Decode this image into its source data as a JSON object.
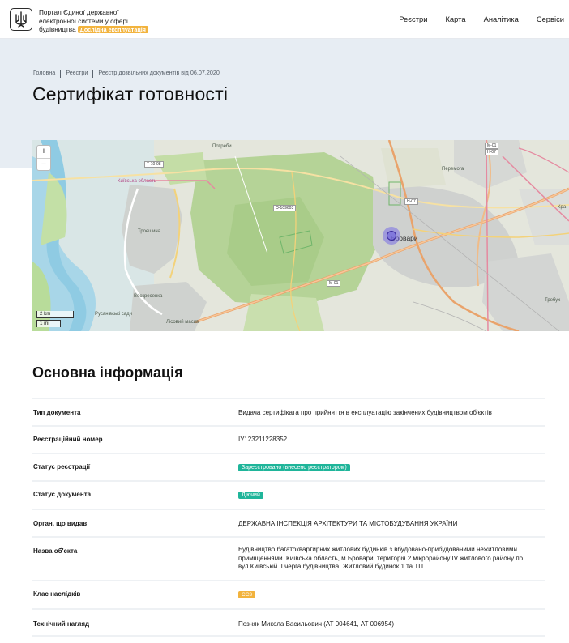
{
  "header": {
    "portal_title_line1": "Портал Єдиної державної",
    "portal_title_line2": "електронної системи у сфері",
    "portal_title_line3": "будівництва",
    "beta_badge": "Дослідна експлуатація",
    "logo_icon": "trident-icon",
    "nav": [
      {
        "label": "Реєстри"
      },
      {
        "label": "Карта"
      },
      {
        "label": "Аналітика"
      },
      {
        "label": "Сервіси"
      }
    ]
  },
  "breadcrumb": [
    "Головна",
    "Реєстри",
    "Реєстр дозвільних документів від 06.07.2020"
  ],
  "page_title": "Сертифікат готовності",
  "map": {
    "zoom_in": "+",
    "zoom_out": "−",
    "scale_km": "2 km",
    "scale_mi": "1 mi",
    "labels": {
      "potrebi": "Потреби",
      "kyiv_oblast": "Київська область",
      "troieshchyna": "Троєщина",
      "voskresenka": "Воскресенка",
      "rusanivski_sady": "Русанівські сади",
      "lisovyi_masyv": "Лісовий масив",
      "peremoha": "Перемога",
      "brovary": "Бровари",
      "krasylivka": "Кра",
      "trebukhiv": "Требух"
    },
    "roads": {
      "t1008": "Т-10-08",
      "o109603": "О-109603",
      "h07": "Н-07",
      "m01_top": "М-01",
      "m01": "М-01",
      "h07b": "Н-07"
    },
    "colors": {
      "forest": "#b8d49a",
      "water": "#9fd3ea",
      "urban": "#c9ccc9",
      "road_main": "#f0b57a",
      "road_pink": "#e78aa0"
    }
  },
  "section_title": "Основна інформація",
  "info": {
    "doc_type_label": "Тип документа",
    "doc_type_value": "Видача сертифіката про прийняття в експлуатацію закінчених будівництвом об'єктів",
    "reg_number_label": "Реєстраційний номер",
    "reg_number_value": "IУ123211228352",
    "reg_status_label": "Статус реєстрації",
    "reg_status_value": "Зареєстровано (внесено реєстратором)",
    "doc_status_label": "Статус документа",
    "doc_status_value": "Діючий",
    "issuer_label": "Орган, що видав",
    "issuer_value": "ДЕРЖАВНА ІНСПЕКЦІЯ АРХІТЕКТУРИ ТА МІСТОБУДУВАННЯ УКРАЇНИ",
    "object_name_label": "Назва об'єкта",
    "object_name_value": "Будівництво багатоквартирних житлових будинків з вбудовано-прибудованими нежитловими приміщеннями. Київська область, м.Бровари, територія 2 мікрорайону IV житлового району по вул.Київській. I черга будівництва. Житловий будинок 1 та ТП.",
    "consequence_class_label": "Клас наслідків",
    "consequence_class_value": "СС3",
    "tech_supervision_label": "Технічний нагляд",
    "tech_supervision_value": "Позняк Микола Васильович (АТ 004641, АТ 006954)"
  },
  "accent": {
    "badge_green": "#1fb59a",
    "badge_orange": "#f2b33d",
    "hero_bg": "#e7edf3"
  }
}
